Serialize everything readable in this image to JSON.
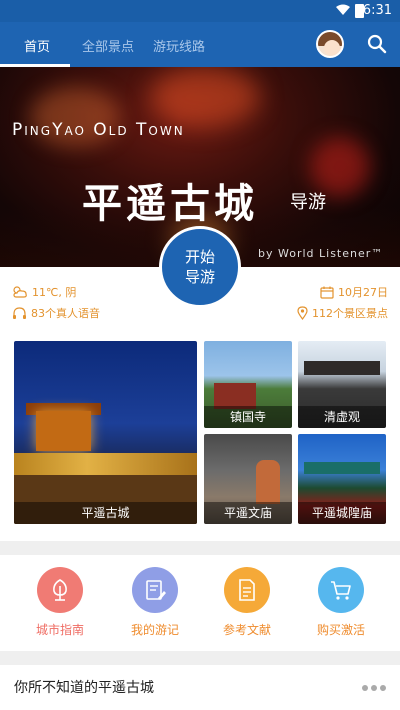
{
  "status_bar": {
    "time": "6:31"
  },
  "app_bar": {
    "tabs": [
      {
        "label": "首页",
        "active": true
      },
      {
        "label": "全部景点",
        "active": false
      },
      {
        "label": "游玩线路",
        "active": false
      }
    ],
    "avatar_icon": "user-avatar",
    "search_icon": "search-icon"
  },
  "hero": {
    "title_en": "PingYao Old Town",
    "title_cn": "平遥古城",
    "subtitle": "导游",
    "byline": "by World Listener™"
  },
  "start_button": {
    "line1": "开始",
    "line2": "导游"
  },
  "info": {
    "weather": "11℃, 阴",
    "voice": "83个真人语音",
    "date": "10月27日",
    "spots": "112个景区景点",
    "accent_color": "#e3932e"
  },
  "photos": [
    {
      "caption": "平遥古城"
    },
    {
      "caption": "镇国寺"
    },
    {
      "caption": "清虚观"
    },
    {
      "caption": "平遥文庙"
    },
    {
      "caption": "平遥城隍庙"
    }
  ],
  "features": [
    {
      "label": "城市指南",
      "icon": "tree-icon",
      "color": "#f07b74"
    },
    {
      "label": "我的游记",
      "icon": "edit-note-icon",
      "color": "#8f9ee6"
    },
    {
      "label": "参考文献",
      "icon": "document-icon",
      "color": "#f5a938"
    },
    {
      "label": "购买激活",
      "icon": "cart-icon",
      "color": "#56b7ee"
    }
  ],
  "article": {
    "title": "你所不知道的平遥古城"
  },
  "colors": {
    "primary": "#1e64b2"
  }
}
